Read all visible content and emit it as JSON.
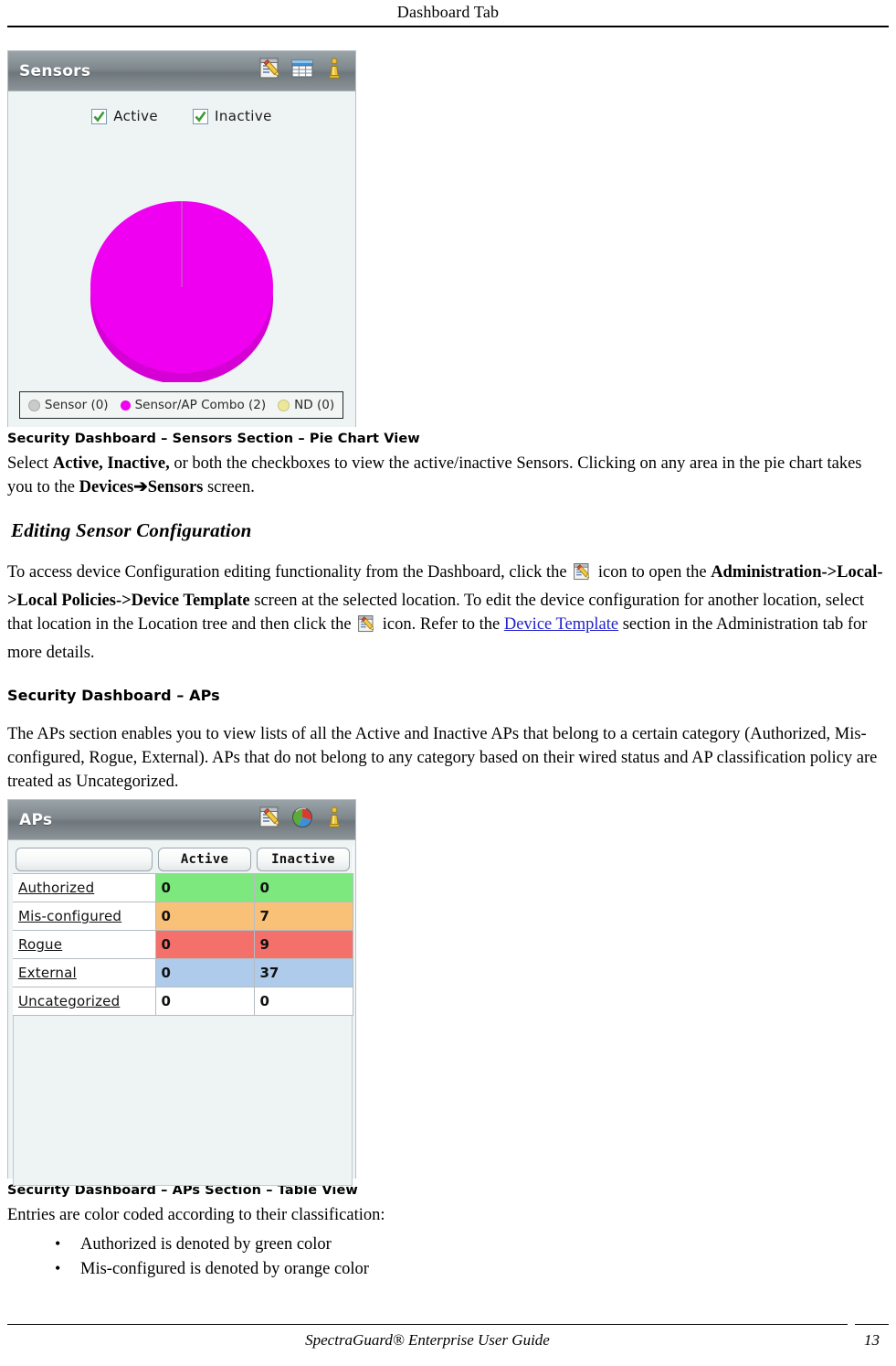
{
  "page": {
    "running_header": "Dashboard Tab",
    "footer_text": "SpectraGuard® Enterprise User Guide",
    "page_number": "13"
  },
  "sensors_widget": {
    "title": "Sensors",
    "icons": [
      "edit-icon",
      "table-view-icon",
      "info-icon"
    ],
    "checkboxes": [
      {
        "label": "Active",
        "checked": true
      },
      {
        "label": "Inactive",
        "checked": true
      }
    ],
    "chart_data": {
      "type": "pie",
      "title": "Sensors",
      "categories": [
        "Sensor (0)",
        "Sensor/AP Combo (2)",
        "ND (0)"
      ],
      "labels": [
        "Sensor",
        "Sensor/AP Combo",
        "ND"
      ],
      "values": [
        0,
        2,
        0
      ],
      "colors": [
        "#c9cacb",
        "#f000f0",
        "#ece79a"
      ],
      "legend_position": "bottom",
      "grid": false
    }
  },
  "figure_caption_1": "Security Dashboard – Sensors Section – Pie Chart View",
  "paragraph_1": {
    "part1": "Select ",
    "bold1": "Active, Inactive,",
    "part2": " or both the checkboxes to view the active/inactive Sensors. Clicking on any area in the pie chart takes you to the ",
    "bold2": "Devices➔Sensors",
    "part3": " screen."
  },
  "heading_editing": "Editing Sensor Configuration",
  "paragraph_2": {
    "part1": "To access device Configuration editing functionality from the Dashboard, click the ",
    "icon1": "edit-icon",
    "part2": " icon to open the ",
    "bold1": "Administration->Local->Local Policies->Device Template",
    "part3": " screen at the selected location. To edit the device configuration for another location, select that location in the Location tree and then click the ",
    "icon2": "edit-icon",
    "part4": " icon. Refer to the ",
    "link": "Device Template",
    "part5": " section in the Administration tab for more details."
  },
  "heading_aps": "Security Dashboard – APs",
  "paragraph_3": "The APs section enables you to view lists of all the Active and Inactive APs that belong to a certain category (Authorized, Mis-configured, Rogue, External). APs that do not belong to any category based on their wired status and AP classification policy are treated as Uncategorized.",
  "aps_widget": {
    "title": "APs",
    "icons": [
      "edit-icon",
      "pie-chart-icon",
      "info-icon"
    ],
    "columns": [
      "",
      "Active",
      "Inactive"
    ],
    "rows": [
      {
        "label": "Authorized",
        "active": "0",
        "inactive": "0",
        "color": "#7de87d"
      },
      {
        "label": "Mis-configured",
        "active": "0",
        "inactive": "7",
        "color": "#f9c177"
      },
      {
        "label": "Rogue",
        "active": "0",
        "inactive": "9",
        "color": "#f4706a"
      },
      {
        "label": "External",
        "active": "0",
        "inactive": "37",
        "color": "#aecbeb"
      },
      {
        "label": "Uncategorized",
        "active": "0",
        "inactive": "0",
        "color": "#ffffff"
      }
    ]
  },
  "figure_caption_2": "Security Dashboard – APs Section – Table View",
  "paragraph_4": "Entries are color coded according to their classification:",
  "bullets": [
    "Authorized is denoted by green color",
    "Mis-configured is denoted by orange color"
  ]
}
